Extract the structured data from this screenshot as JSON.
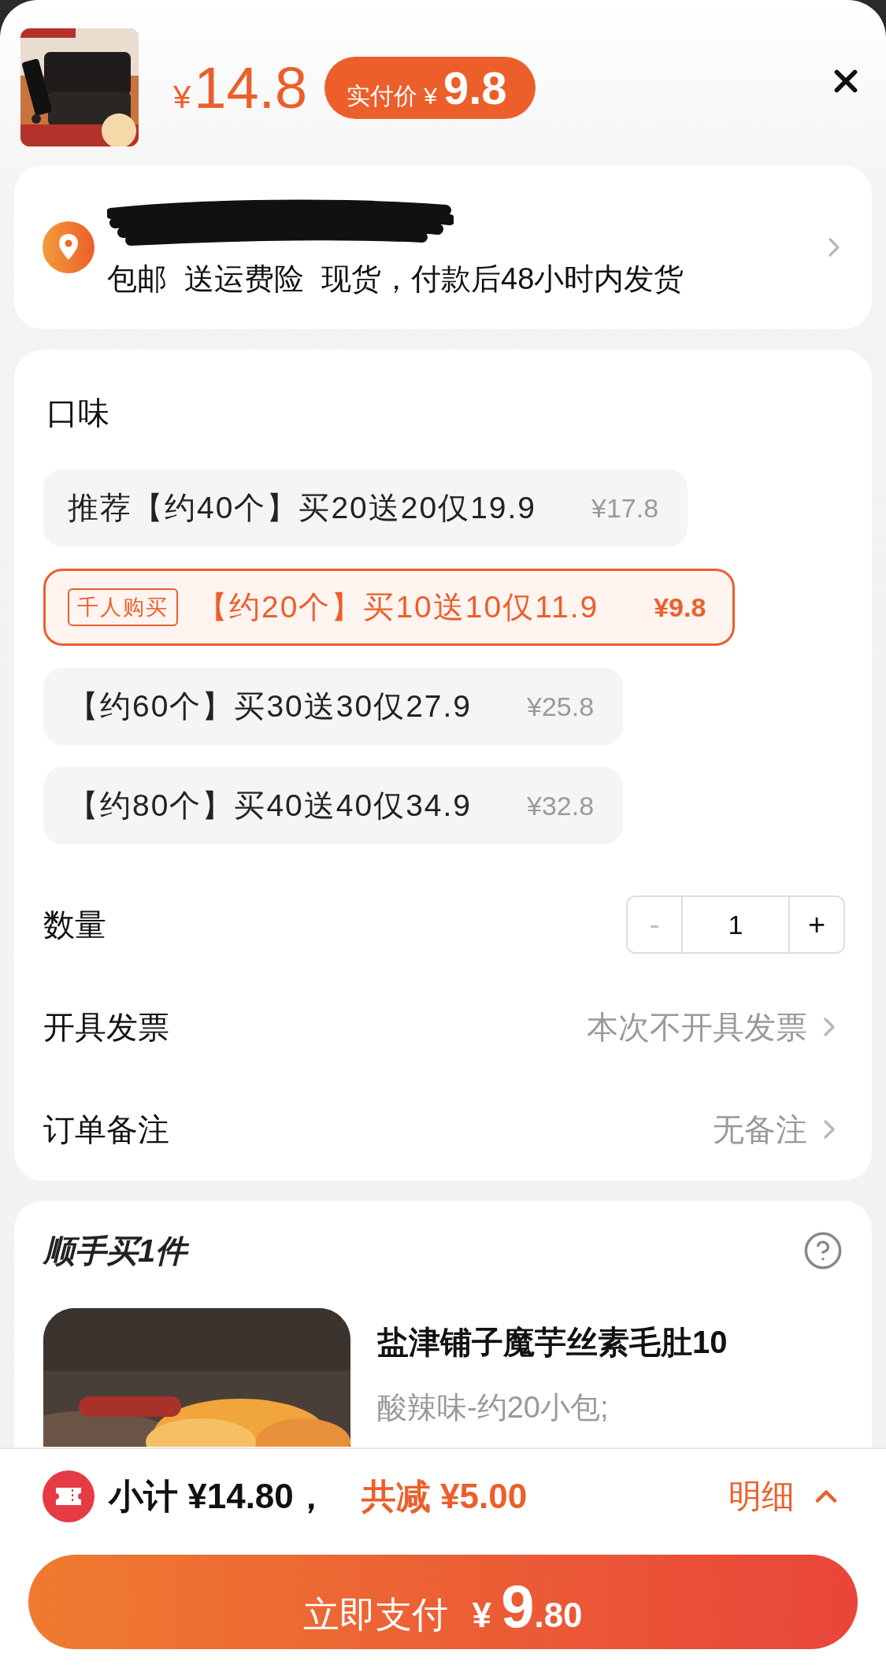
{
  "header": {
    "original_price": {
      "currency": "¥",
      "amount": "14.8"
    },
    "pay_badge": {
      "label": "实付价",
      "currency": "¥",
      "amount": "9.8"
    }
  },
  "address": {
    "redacted": true,
    "delivery_info": [
      "包邮",
      "送运费险",
      "现货，付款后48小时内发货"
    ]
  },
  "flavor": {
    "title": "口味",
    "options": [
      {
        "label": "推荐【约40个】买20送20仅19.9",
        "price": "¥17.8",
        "selected": false
      },
      {
        "badge": "千人购买",
        "label": "【约20个】买10送10仅11.9",
        "price": "¥9.8",
        "selected": true
      },
      {
        "label": "【约60个】买30送30仅27.9",
        "price": "¥25.8",
        "selected": false
      },
      {
        "label": "【约80个】买40送40仅34.9",
        "price": "¥32.8",
        "selected": false
      }
    ]
  },
  "quantity": {
    "label": "数量",
    "minus": "-",
    "value": "1",
    "plus": "+",
    "minus_disabled": true
  },
  "rows": [
    {
      "label": "开具发票",
      "value": "本次不开具发票"
    },
    {
      "label": "订单备注",
      "value": "无备注"
    }
  ],
  "add_on": {
    "title": "顺手买1件",
    "product": {
      "kind": "picture",
      "name": "盐津铺子魔芋丝素毛肚10",
      "variant": "酸辣味-约20小包;"
    }
  },
  "summary": {
    "subtotal": "小计 ¥14.80，",
    "discount": "共减 ¥5.00",
    "details": "明细"
  },
  "pay_button": {
    "label": "立即支付",
    "currency": "¥",
    "whole": "9",
    "fraction": ".80"
  }
}
